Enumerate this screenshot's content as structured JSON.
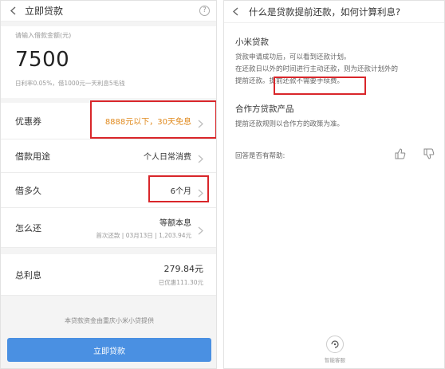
{
  "left": {
    "header_title": "立即贷款",
    "help_glyph": "?",
    "amount_label": "请输入借款金额(元)",
    "amount_value": "7500",
    "amount_note": "日利率0.05%，借1000元一天利息5毛钱",
    "coupon": {
      "label": "优惠券",
      "value": "8888元以下，30天免息"
    },
    "purpose": {
      "label": "借款用途",
      "value": "个人日常消费"
    },
    "term": {
      "label": "借多久",
      "value": "6个月"
    },
    "repay": {
      "label": "怎么还",
      "value": "等额本息",
      "sub": "首次还款 | 03月13日 | 1,203.94元"
    },
    "interest": {
      "label": "总利息",
      "value": "279.84元",
      "sub": "已优惠111.30元"
    },
    "footer_note": "本贷款资金由重庆小米小贷提供",
    "apply_button": "立即贷款",
    "highlight_color": "#d9262a",
    "accent_color": "#4a90e2",
    "coupon_color": "#e08a1e"
  },
  "right": {
    "header_title": "什么是贷款提前还款，如何计算利息?",
    "xiaomi": {
      "title": "小米贷款",
      "lines": [
        "贷款申请成功后，可以看到还款计划。",
        "在还款日以外的时间进行主动还款，则为还款计划外的",
        "提前还款。",
        "提前还款不需要手续费。"
      ]
    },
    "partner": {
      "title": "合作方贷款产品",
      "text": "提前还款规则以合作方的政策为准。"
    },
    "helpful_question": "回答是否有帮助:",
    "assistant_caption": "智能客服"
  }
}
